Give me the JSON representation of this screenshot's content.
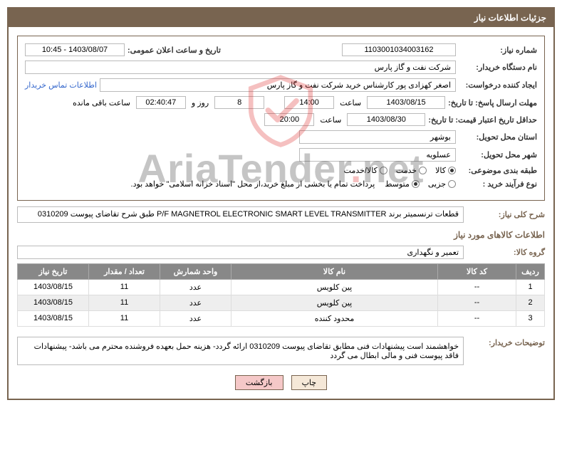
{
  "header": "جزئیات اطلاعات نیاز",
  "labels": {
    "need_no": "شماره نیاز:",
    "announce": "تاریخ و ساعت اعلان عمومی:",
    "buyer_org": "نام دستگاه خریدار:",
    "requester": "ایجاد کننده درخواست:",
    "contact_link": "اطلاعات تماس خریدار",
    "reply_deadline": "مهلت ارسال پاسخ: تا تاریخ:",
    "time_lbl": "ساعت",
    "days_and": "روز و",
    "remaining": "ساعت باقی مانده",
    "min_valid": "حداقل تاریخ اعتبار قیمت: تا تاریخ:",
    "province": "استان محل تحویل:",
    "city": "شهر محل تحویل:",
    "category": "طبقه بندی موضوعی:",
    "purchase_type": "نوع فرآیند خرید :",
    "treasury_note": "پرداخت تمام یا بخشی از مبلغ خرید،از محل \"اسناد خزانه اسلامی\" خواهد بود.",
    "overall_desc": "شرح کلی نیاز:",
    "items_section": "اطلاعات کالاهای مورد نیاز",
    "goods_group": "گروه کالا:",
    "buyer_notes": "توضیحات خریدار:"
  },
  "values": {
    "need_no": "1103001034003162",
    "announce": "1403/08/07 - 10:45",
    "buyer_org": "شرکت نفت و گاز پارس",
    "requester": "اصغر کهزادی پور کارشناس خرید شرکت نفت و گاز پارس",
    "reply_date": "1403/08/15",
    "reply_time": "14:00",
    "days_remaining": "8",
    "time_remaining": "02:40:47",
    "valid_date": "1403/08/30",
    "valid_time": "20:00",
    "province": "بوشهر",
    "city": "عسلویه",
    "overall_desc": "قطعات ترنسمیتر برند P/F MAGNETROL ELECTRONIC SMART LEVEL TRANSMITTER طبق شرح تقاضای پیوست 0310209",
    "goods_group": "تعمیر و نگهداری",
    "buyer_notes": "خواهشمند است پیشنهادات فنی مطابق تقاضای پیوست 0310209 ارائه گردد- هزینه حمل بعهده فروشنده محترم می باشد- پیشنهادات فاقد پیوست فنی و مالی ابطال می گردد"
  },
  "category_options": [
    "کالا",
    "خدمت",
    "کالا/خدمت"
  ],
  "category_selected": 0,
  "purchase_options": [
    "جزیی",
    "متوسط"
  ],
  "purchase_selected": 1,
  "table": {
    "headers": [
      "ردیف",
      "کد کالا",
      "نام کالا",
      "واحد شمارش",
      "تعداد / مقدار",
      "تاریخ نیاز"
    ],
    "rows": [
      {
        "n": "1",
        "code": "--",
        "name": "پین کلویس",
        "unit": "عدد",
        "qty": "11",
        "date": "1403/08/15"
      },
      {
        "n": "2",
        "code": "--",
        "name": "پین کلویس",
        "unit": "عدد",
        "qty": "11",
        "date": "1403/08/15"
      },
      {
        "n": "3",
        "code": "--",
        "name": "محدود کننده",
        "unit": "عدد",
        "qty": "11",
        "date": "1403/08/15"
      }
    ]
  },
  "buttons": {
    "print": "چاپ",
    "back": "بازگشت"
  },
  "watermark": "AriaTender.net",
  "watermark_dot": "."
}
